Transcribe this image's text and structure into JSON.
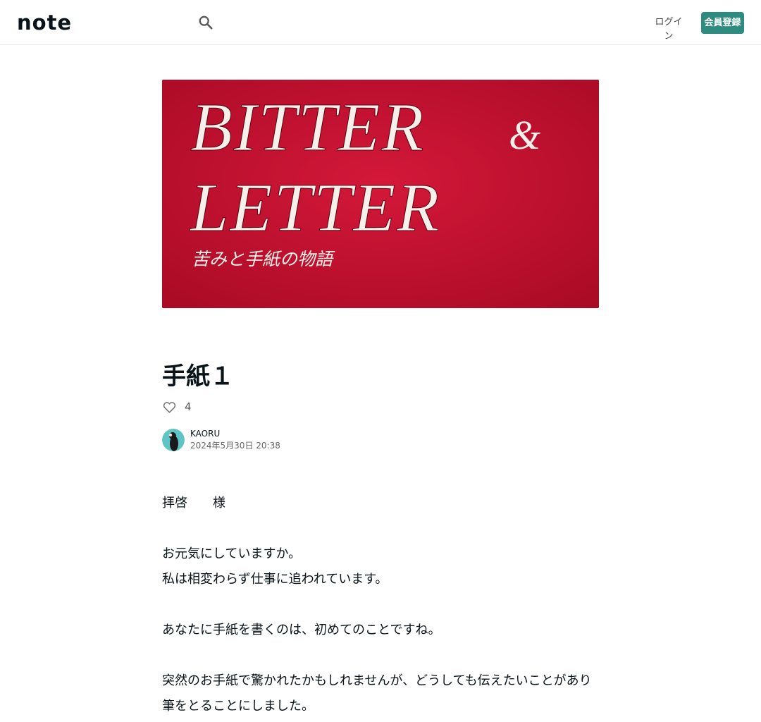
{
  "header": {
    "logo_text": "note",
    "search_icon": "search-icon",
    "login_label": "ログイン",
    "signup_label": "会員登録"
  },
  "hero": {
    "line1": "BITTER",
    "amp": "&",
    "line2": "LETTER",
    "subtitle": "苦みと手紙の物語",
    "background_color": "#c8102e"
  },
  "article": {
    "title": "手紙１",
    "like_icon": "heart-icon",
    "like_count": "4",
    "author_name": "KAORU",
    "date": "2024年5月30日 20:38"
  },
  "body": {
    "paragraphs": [
      "拝啓　　様",
      "",
      "お元気にしていますか。",
      "私は相変わらず仕事に追われています。",
      "",
      "あなたに手紙を書くのは、初めてのことですね。",
      "",
      "突然のお手紙で驚かれたかもしれませんが、どうしても伝えたいことがあり",
      "筆をとることにしました。"
    ]
  },
  "colors": {
    "accent": "#2d8c7f",
    "text": "#08131a",
    "hero_red": "#c8102e"
  }
}
